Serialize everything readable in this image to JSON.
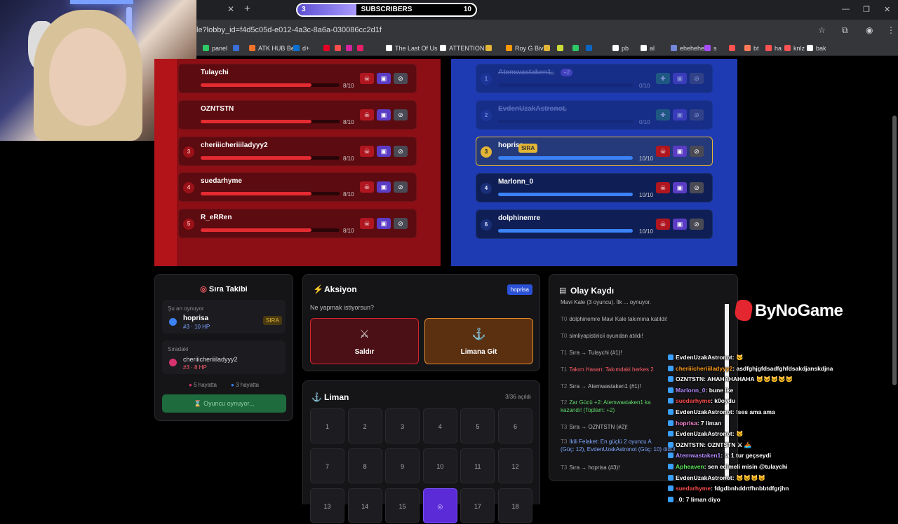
{
  "overlay": {
    "subscribers_label": "SUBSCRIBERS",
    "subscribers_current": "3",
    "subscribers_goal": "10",
    "subscribers_progress": 0.3,
    "logo_text": "ByNoGame"
  },
  "browser": {
    "url": "le?lobby_id=f4d5c05d-e012-4a3c-8a6a-030086cc2d1f",
    "bookmarks": [
      {
        "label": "panel",
        "color": "#2ec866"
      },
      {
        "label": "",
        "color": "#3b6fd8"
      },
      {
        "label": "ATK HUB Beta",
        "color": "#f0722a"
      },
      {
        "label": "d+",
        "color": "#0b6fd0"
      },
      {
        "label": "",
        "color": "#e60023"
      },
      {
        "label": "",
        "color": "#ff4d4d"
      },
      {
        "label": "",
        "color": "#d6249f"
      },
      {
        "label": "",
        "color": "#e91e63"
      },
      {
        "label": "The Last Of Us",
        "color": "#ffffff"
      },
      {
        "label": "ATTENTION",
        "color": "#ffffff"
      },
      {
        "label": "",
        "color": "#e3b536"
      },
      {
        "label": "Roy G Biv",
        "color": "#ff9800"
      },
      {
        "label": "",
        "color": "#e3b536"
      },
      {
        "label": "",
        "color": "#cddc39"
      },
      {
        "label": "",
        "color": "#2ec866"
      },
      {
        "label": "",
        "color": "#0a66c2"
      },
      {
        "label": "pb",
        "color": "#ffffff"
      },
      {
        "label": "al",
        "color": "#ffffff"
      },
      {
        "label": "ehehehee",
        "color": "#7289da"
      },
      {
        "label": "s",
        "color": "#a64dff"
      },
      {
        "label": "",
        "color": "#ff5252"
      },
      {
        "label": "bt",
        "color": "#ff7a59"
      },
      {
        "label": "ha",
        "color": "#ff5252"
      },
      {
        "label": "knlz",
        "color": "#ff5252"
      },
      {
        "label": "bak",
        "color": "#ffffff"
      }
    ]
  },
  "red_team": [
    {
      "num": "",
      "name": "Tulaychi",
      "hp": "8/10",
      "hp_value": 8,
      "hp_max": 10
    },
    {
      "num": "",
      "name": "OZNTSTN",
      "hp": "8/10",
      "hp_value": 8,
      "hp_max": 10
    },
    {
      "num": "3",
      "name": "cheriiicheriiiladyyy2",
      "hp": "8/10",
      "hp_value": 8,
      "hp_max": 10
    },
    {
      "num": "4",
      "name": "suedarhyme",
      "hp": "8/10",
      "hp_value": 8,
      "hp_max": 10
    },
    {
      "num": "5",
      "name": "R_eRRen",
      "hp": "8/10",
      "hp_value": 8,
      "hp_max": 10
    }
  ],
  "blue_team": [
    {
      "num": "1",
      "name": "Atemwastaken1",
      "hp": "0/10",
      "hp_value": 0,
      "hp_max": 10,
      "extra": "+2",
      "dim": true
    },
    {
      "num": "2",
      "name": "EvdenUzakAstronot",
      "hp": "0/10",
      "hp_value": 0,
      "hp_max": 10,
      "dim": true
    },
    {
      "num": "3",
      "name": "hoprisa",
      "hp": "10/10",
      "hp_value": 10,
      "hp_max": 10,
      "tag": "SIRA",
      "active": true
    },
    {
      "num": "4",
      "name": "Marlonn_0",
      "hp": "10/10",
      "hp_value": 10,
      "hp_max": 10
    },
    {
      "num": "6",
      "name": "dolphinemre",
      "hp": "10/10",
      "hp_value": 10,
      "hp_max": 10
    }
  ],
  "turn": {
    "title": "Sıra Takibi",
    "now_label": "Şu an oynuyor",
    "now_name": "hoprisa",
    "now_meta": "#3 · 10 HP",
    "now_tag": "SIRA",
    "next_label": "Sıradaki",
    "next_name": "cheriiicheriiiladyyy2",
    "next_meta": "#3 · 8 HP",
    "red_alive": "5 hayatta",
    "blue_alive": "3 hayatta",
    "status_button": "⌛ Oyuncu oynuyor..."
  },
  "action": {
    "title": "Aksiyon",
    "badge": "hoprisa",
    "question": "Ne yapmak istiyorsun?",
    "attack_label": "Saldır",
    "port_label": "Limana Git"
  },
  "harbor": {
    "title": "Liman",
    "count": "3/36 açıldı",
    "cells": [
      "1",
      "2",
      "3",
      "4",
      "5",
      "6",
      "7",
      "8",
      "9",
      "10",
      "11",
      "12",
      "13",
      "14",
      "15",
      "",
      "17",
      "18"
    ],
    "selected_index": 15
  },
  "log": {
    "title": "Olay Kaydı",
    "entries": [
      {
        "t": "",
        "text": "Mavi Kale (3 oyuncu). İlk ... oynuyor.",
        "cls": ""
      },
      {
        "t": "T0",
        "text": "dolphinemre Mavi Kale takımına katıldı!",
        "cls": ""
      },
      {
        "t": "T0",
        "text": "simliyapistiricii oyundan atıldı!",
        "cls": ""
      },
      {
        "t": "T1",
        "text": "Sıra → Tulaychi (#1)!",
        "cls": ""
      },
      {
        "t": "T1",
        "text": "Takım Hasarı: Takımdaki herkes 2",
        "cls": "red"
      },
      {
        "t": "T2",
        "text": "Sıra → Atemwastaken1 (#1)!",
        "cls": ""
      },
      {
        "t": "T2",
        "text": "Zar Gücü +2: Atemwastaken1 ka",
        "cls": "green"
      },
      {
        "t": "",
        "text": "kazandı! (Toplam: +2)",
        "cls": "green"
      },
      {
        "t": "T3",
        "text": "Sıra → OZNTSTN (#2)!",
        "cls": ""
      },
      {
        "t": "T3",
        "text": "İkili Felaket: En güçlü 2 oyuncu A",
        "cls": "blue"
      },
      {
        "t": "",
        "text": "(Güç: 12), EvdenUzakAstronot (Güç: 10) öldü!",
        "cls": "blue"
      },
      {
        "t": "T3",
        "text": "Sıra → hoprisa (#3)!",
        "cls": ""
      }
    ]
  },
  "chat": [
    {
      "user": "EvdenUzakAstronot",
      "msg": ": 🐱",
      "color": "#ffffff"
    },
    {
      "user": "cheriiicheriiiladyyy2",
      "msg": ": asdfghjgfdsadfghfdsakdjanskdjna",
      "color": "#ff9f1c"
    },
    {
      "user": "OZNTSTN",
      "msg": ": AHAHAHAHAHA 🐱🐱🐱🐱🐱",
      "color": "#ffffff"
    },
    {
      "user": "Marlonn_0",
      "msg": ": bune lke",
      "color": "#b48cff"
    },
    {
      "user": "suedarhyme",
      "msg": ": k0oydu",
      "color": "#ff4d4d"
    },
    {
      "user": "EvdenUzakAstronot",
      "msg": ": !ses ama ama",
      "color": "#ffffff"
    },
    {
      "user": "hoprisa",
      "msg": ": 7 liman",
      "color": "#ff8ad8"
    },
    {
      "user": "EvdenUzakAstronot",
      "msg": ": 🐱",
      "color": "#ffffff"
    },
    {
      "user": "OZNTSTN",
      "msg": ": OZNTSTN ⚔ 🚣",
      "color": "#ffffff"
    },
    {
      "user": "Atemwastaken1",
      "msg": ": la 1 tur geçseydi",
      "color": "#b48cff"
    },
    {
      "user": "Apheaven",
      "msg": ": sen edimeli misin @tulaychi",
      "color": "#5ce65c"
    },
    {
      "user": "EvdenUzakAstronot",
      "msg": ": 🐱🐱🐱🐱",
      "color": "#ffffff"
    },
    {
      "user": "suedarhyme",
      "msg": ": fdgdbnhddrtfhnbbtdfgrjhn",
      "color": "#ff4d4d"
    },
    {
      "user": "_0",
      "msg": ": 7 liman diyo",
      "color": "#ffffff"
    }
  ]
}
